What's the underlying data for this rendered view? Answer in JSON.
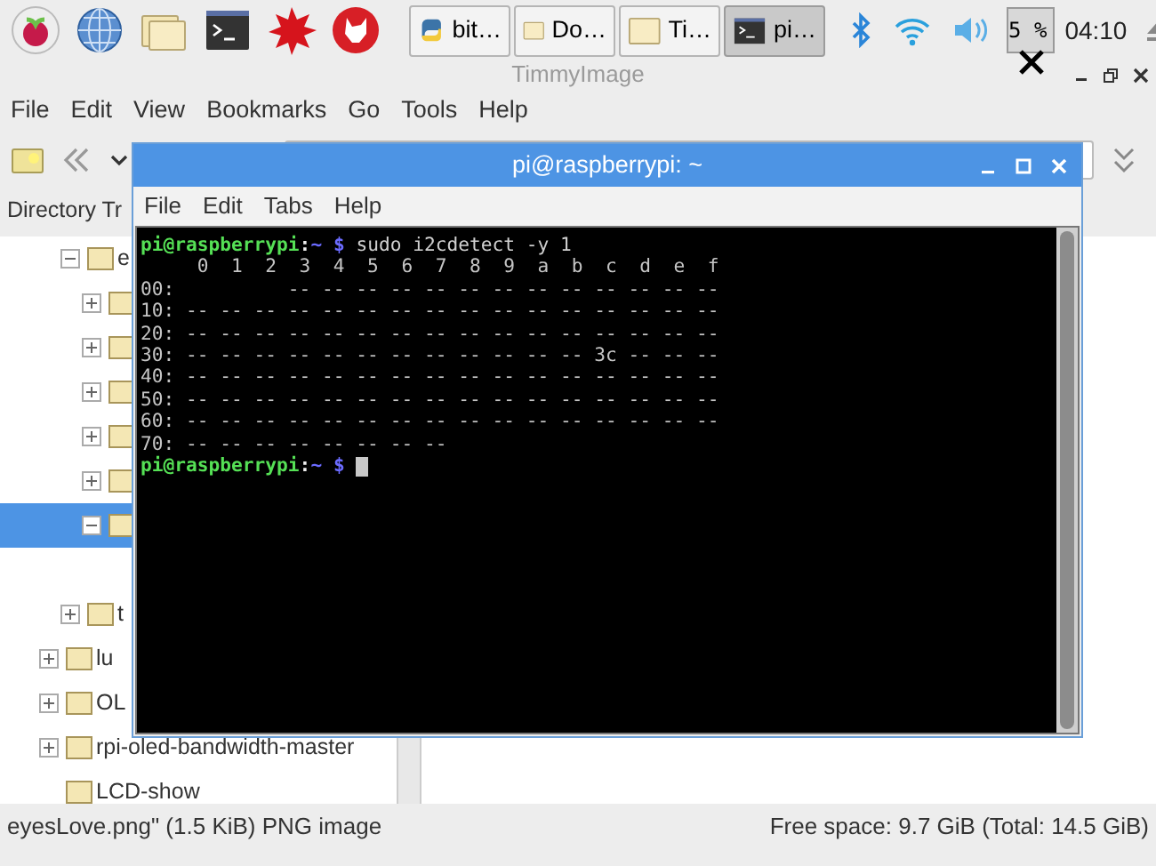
{
  "taskbar": {
    "tasks": [
      {
        "label": "bit…",
        "kind": "python",
        "selected": false
      },
      {
        "label": "Do…",
        "kind": "folder",
        "selected": false
      },
      {
        "label": "Ti…",
        "kind": "folder",
        "selected": false
      },
      {
        "label": "pi…",
        "kind": "terminal",
        "selected": true
      }
    ],
    "cpu": "5 %",
    "clock": "04:10"
  },
  "file_manager": {
    "title": "TimmyImage",
    "menu": [
      "File",
      "Edit",
      "View",
      "Bookmarks",
      "Go",
      "Tools",
      "Help"
    ],
    "sidebar_title": "Directory Tr",
    "tree": {
      "continued": [
        {
          "label": "e",
          "expanded": true,
          "selected": false,
          "children": [
            {
              "expanded": false,
              "selected": false
            },
            {
              "expanded": false,
              "selected": false
            },
            {
              "expanded": false,
              "selected": false
            },
            {
              "expanded": false,
              "selected": false
            },
            {
              "expanded": false,
              "selected": false
            },
            {
              "expanded": true,
              "selected": true,
              "children": [
                {
                  "selected": false
                }
              ]
            }
          ]
        },
        {
          "label": "t",
          "expanded": false,
          "selected": false
        }
      ],
      "items": [
        {
          "label": "lu",
          "expanded": false,
          "selected": false
        },
        {
          "label": "OL",
          "expanded": false,
          "selected": false
        },
        {
          "label": "rpi-oled-bandwidth-master",
          "expanded": false,
          "selected": false
        },
        {
          "label": "LCD-show",
          "selected": false
        }
      ]
    },
    "status_bar": {
      "file": "eyesLove.png\" (1.5 KiB) PNG image",
      "free_space": "Free space: 9.7 GiB (Total: 14.5 GiB)"
    }
  },
  "terminal": {
    "title": "pi@raspberrypi: ~",
    "menu": [
      "File",
      "Edit",
      "Tabs",
      "Help"
    ],
    "lines": [
      {
        "kind": "prompt",
        "user": "pi@raspberrypi",
        "sep": ":",
        "path": "~",
        "symbol": "$",
        "command": "sudo i2cdetect -y 1"
      },
      {
        "kind": "output",
        "text": "     0  1  2  3  4  5  6  7  8  9  a  b  c  d  e  f"
      },
      {
        "kind": "output",
        "text": "00:          -- -- -- -- -- -- -- -- -- -- -- -- --"
      },
      {
        "kind": "output",
        "text": "10: -- -- -- -- -- -- -- -- -- -- -- -- -- -- -- --"
      },
      {
        "kind": "output",
        "text": "20: -- -- -- -- -- -- -- -- -- -- -- -- -- -- -- --"
      },
      {
        "kind": "output",
        "text": "30: -- -- -- -- -- -- -- -- -- -- -- -- 3c -- -- --"
      },
      {
        "kind": "output",
        "text": "40: -- -- -- -- -- -- -- -- -- -- -- -- -- -- -- --"
      },
      {
        "kind": "output",
        "text": "50: -- -- -- -- -- -- -- -- -- -- -- -- -- -- -- --"
      },
      {
        "kind": "output",
        "text": "60: -- -- -- -- -- -- -- -- -- -- -- -- -- -- -- --"
      },
      {
        "kind": "output",
        "text": "70: -- -- -- -- -- -- -- --"
      },
      {
        "kind": "prompt",
        "user": "pi@raspberrypi",
        "sep": ":",
        "path": "~",
        "symbol": "$",
        "cursor": true
      }
    ]
  }
}
